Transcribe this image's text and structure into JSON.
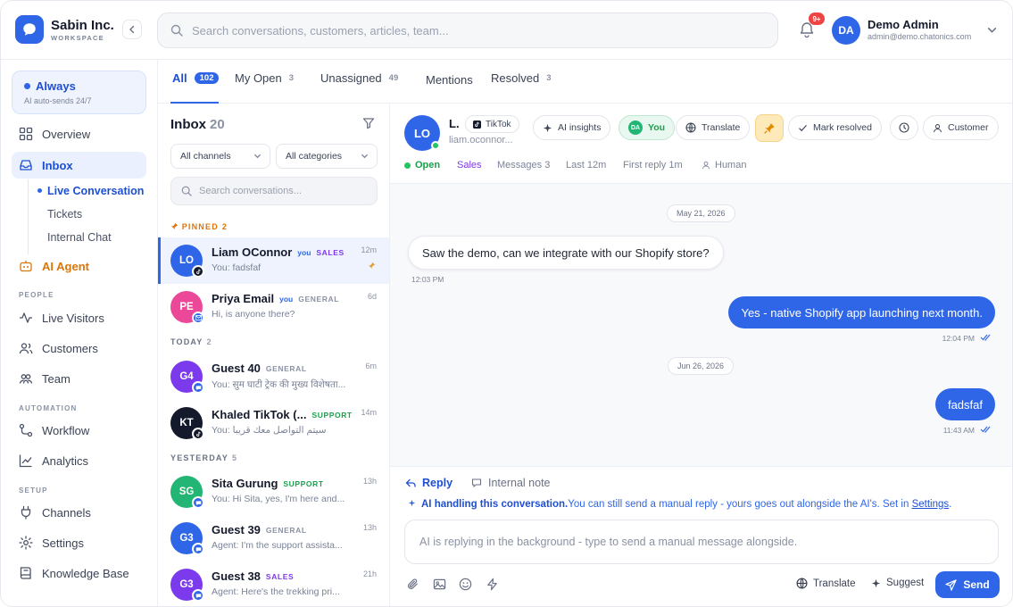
{
  "workspace": {
    "name": "Sabin Inc.",
    "subtitle": "WORKSPACE",
    "logo_icon": "chat-bubble-icon"
  },
  "search": {
    "placeholder": "Search conversations, customers, articles, team..."
  },
  "notifications": {
    "badge": "9+"
  },
  "user": {
    "initials": "DA",
    "name": "Demo Admin",
    "email": "admin@demo.chatonics.com"
  },
  "ai_mode": {
    "title": "Always",
    "subtitle": "AI auto-sends 24/7"
  },
  "sidebar": {
    "overview": "Overview",
    "inbox": "Inbox",
    "inbox_sub": [
      "Live Conversation",
      "Tickets",
      "Internal Chat"
    ],
    "ai_agent": "AI Agent",
    "section_people": "PEOPLE",
    "live_visitors": "Live Visitors",
    "customers": "Customers",
    "team": "Team",
    "section_automation": "AUTOMATION",
    "workflow": "Workflow",
    "analytics": "Analytics",
    "section_setup": "SETUP",
    "channels": "Channels",
    "settings": "Settings",
    "knowledge_base": "Knowledge Base"
  },
  "tabs": [
    {
      "label": "All",
      "count": "102"
    },
    {
      "label": "My Open",
      "count": "3"
    },
    {
      "label": "Unassigned",
      "count": "49"
    },
    {
      "label": "Mentions",
      "count": ""
    },
    {
      "label": "Resolved",
      "count": "3"
    }
  ],
  "inbox": {
    "title": "Inbox",
    "count": "20",
    "filter_channels": "All channels",
    "filter_categories": "All categories",
    "search_placeholder": "Search conversations...",
    "groups": [
      {
        "label": "PINNED",
        "count": "2"
      },
      {
        "label": "TODAY",
        "count": "2"
      },
      {
        "label": "YESTERDAY",
        "count": "5"
      }
    ],
    "items": [
      {
        "initials": "LO",
        "name": "Liam OConnor",
        "you": "you",
        "category": "SALES",
        "time": "12m",
        "preview": "You: fadsfaf",
        "color": "#2f66e8",
        "cat_color": "#7c3aed",
        "channel": "tiktok"
      },
      {
        "initials": "PE",
        "name": "Priya Email",
        "you": "you",
        "category": "GENERAL",
        "time": "6d",
        "preview": "Hi, is anyone there?",
        "color": "#ec4899",
        "cat_color": "#8a92a3",
        "channel": "email"
      },
      {
        "initials": "G4",
        "name": "Guest 40",
        "you": "",
        "category": "GENERAL",
        "time": "6m",
        "preview": "You: सुम घाटी ट्रेक की मुख्य विशेषता...",
        "color": "#7c3aed",
        "cat_color": "#8a92a3",
        "channel": "chat"
      },
      {
        "initials": "KT",
        "name": "Khaled TikTok (...",
        "you": "",
        "category": "SUPPORT",
        "time": "14m",
        "preview": "You: سيتم التواصل معك قريبا",
        "color": "#141a2b",
        "cat_color": "#16a34a",
        "channel": "tiktok"
      },
      {
        "initials": "SG",
        "name": "Sita Gurung",
        "you": "",
        "category": "SUPPORT",
        "time": "13h",
        "preview": "You: Hi Sita, yes, I'm here and...",
        "color": "#22b573",
        "cat_color": "#16a34a",
        "channel": "chat"
      },
      {
        "initials": "G3",
        "name": "Guest 39",
        "you": "",
        "category": "GENERAL",
        "time": "13h",
        "preview": "Agent: I'm the support assista...",
        "color": "#2f66e8",
        "cat_color": "#8a92a3",
        "channel": "chat"
      },
      {
        "initials": "G3",
        "name": "Guest 38",
        "you": "",
        "category": "SALES",
        "time": "21h",
        "preview": "Agent: Here's the trekking pri...",
        "color": "#7c3aed",
        "cat_color": "#7c3aed",
        "channel": "chat"
      }
    ]
  },
  "conversation": {
    "initials": "LO",
    "name": "L.",
    "channel": "TikTok",
    "email": "liam.oconnor...",
    "actions": {
      "ai_insights": "AI insights",
      "assignee_initials": "DA",
      "assignee": "You",
      "translate": "Translate",
      "mark_resolved": "Mark resolved",
      "customer": "Customer"
    },
    "meta": {
      "status": "Open",
      "category": "Sales",
      "messages": "Messages 3",
      "last": "Last 12m",
      "first_reply": "First reply 1m",
      "handler": "Human"
    },
    "messages": [
      {
        "date": "May 21, 2026"
      },
      {
        "text": "Saw the demo, can we integrate with our Shopify store?",
        "time": "12:03 PM",
        "direction": "in"
      },
      {
        "text": "Yes - native Shopify app launching next month.",
        "time": "12:04 PM",
        "direction": "out"
      },
      {
        "date": "Jun 26, 2026"
      },
      {
        "text": "fadsfaf",
        "time": "11:43 AM",
        "direction": "out"
      }
    ]
  },
  "composer": {
    "reply_tab": "Reply",
    "note_tab": "Internal note",
    "ai_bold": "AI handling this conversation.",
    "ai_text": "You can still send a manual reply - yours goes out alongside the AI's. Set in ",
    "ai_link": "Settings",
    "ai_end": ".",
    "placeholder": "AI is replying in the background - type to send a manual message alongside.",
    "translate": "Translate",
    "suggest": "Suggest",
    "send": "Send"
  }
}
